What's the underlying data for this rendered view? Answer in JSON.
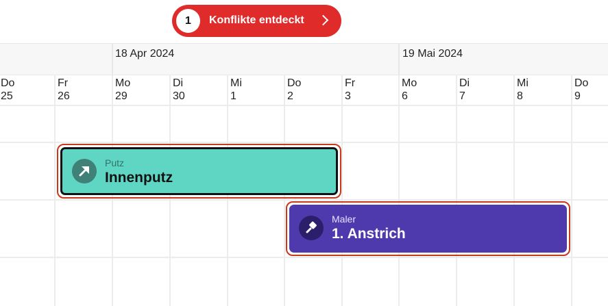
{
  "conflicts": {
    "count": "1",
    "label": "Konflikte entdeckt",
    "color": "#e02b2b"
  },
  "months": [
    {
      "label": "18 Apr 2024"
    },
    {
      "label": "19 Mai 2024"
    }
  ],
  "days": [
    {
      "weekday": "Do",
      "date": "25"
    },
    {
      "weekday": "Fr",
      "date": "26"
    },
    {
      "weekday": "Mo",
      "date": "29"
    },
    {
      "weekday": "Di",
      "date": "30"
    },
    {
      "weekday": "Mi",
      "date": "1"
    },
    {
      "weekday": "Do",
      "date": "2"
    },
    {
      "weekday": "Fr",
      "date": "3"
    },
    {
      "weekday": "Mo",
      "date": "6"
    },
    {
      "weekday": "Di",
      "date": "7"
    },
    {
      "weekday": "Mi",
      "date": "8"
    },
    {
      "weekday": "Do",
      "date": "9"
    }
  ],
  "tasks": [
    {
      "category": "Putz",
      "title": "Innenputz",
      "color": "#5fd6c4",
      "icon": "trowel-icon"
    },
    {
      "category": "Maler",
      "title": "1. Anstrich",
      "color": "#4f3aad",
      "icon": "paint-roller-icon"
    }
  ]
}
